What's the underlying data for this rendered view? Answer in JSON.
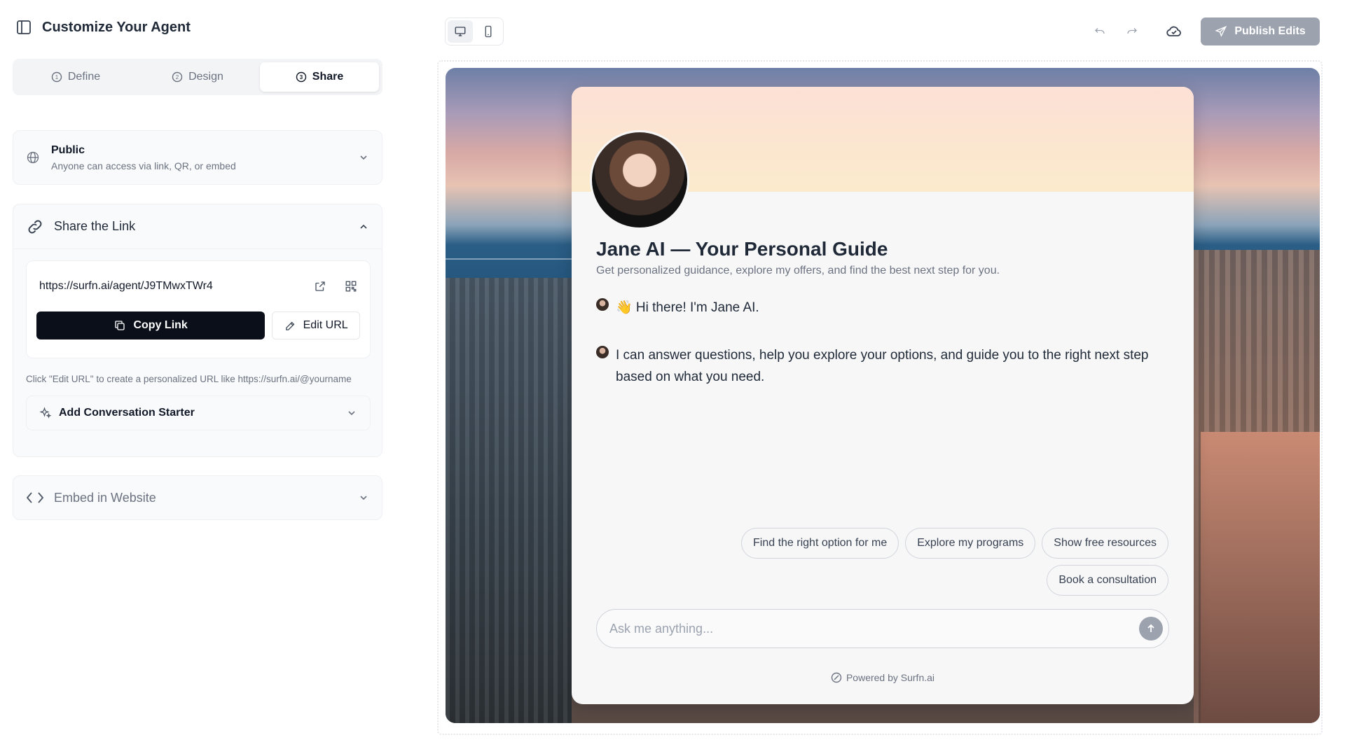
{
  "header": {
    "title": "Customize Your Agent"
  },
  "tabs": [
    {
      "num": "1",
      "label": "Define"
    },
    {
      "num": "2",
      "label": "Design"
    },
    {
      "num": "3",
      "label": "Share"
    }
  ],
  "active_tab": "Share",
  "access": {
    "title": "Public",
    "subtitle": "Anyone can access via link, QR, or embed"
  },
  "share": {
    "title": "Share the Link",
    "url": "https://surfn.ai/agent/J9TMwxTWr4",
    "copy_label": "Copy Link",
    "edit_label": "Edit URL",
    "hint": "Click \"Edit URL\" to create a personalized URL like https://surfn.ai/@yourname",
    "starter_label": "Add Conversation Starter"
  },
  "embed": {
    "title": "Embed in Website"
  },
  "toolbar": {
    "publish_label": "Publish Edits"
  },
  "chat": {
    "title": "Jane AI — Your Personal Guide",
    "subtitle": "Get personalized guidance, explore my offers, and find the best next step for you.",
    "messages": [
      "👋 Hi there! I'm Jane AI.",
      "I can answer questions, help you explore your options, and guide you to the right next step based on what you need."
    ],
    "suggestions": [
      "Find the right option for me",
      "Explore my programs",
      "Show free resources",
      "Book a consultation"
    ],
    "input_placeholder": "Ask me anything...",
    "powered_by": "Powered by Surfn.ai"
  },
  "colors": {
    "primary_button": "#0b0f1a",
    "publish_button": "#9ca3af",
    "panel_bg": "#f9fafb",
    "banner": "#fde0d6"
  },
  "icons": {
    "sidebar": "sidebar-toggle-icon",
    "globe": "globe-icon",
    "link": "link-icon",
    "external": "external-link-icon",
    "qr": "qr-code-icon",
    "copy": "copy-icon",
    "edit": "pencil-icon",
    "sparkle": "sparkle-icon",
    "code": "code-icon",
    "desktop": "desktop-icon",
    "mobile": "mobile-icon",
    "undo": "undo-icon",
    "redo": "redo-icon",
    "cloud": "cloud-check-icon",
    "send": "send-icon",
    "arrow_up": "arrow-up-icon"
  }
}
